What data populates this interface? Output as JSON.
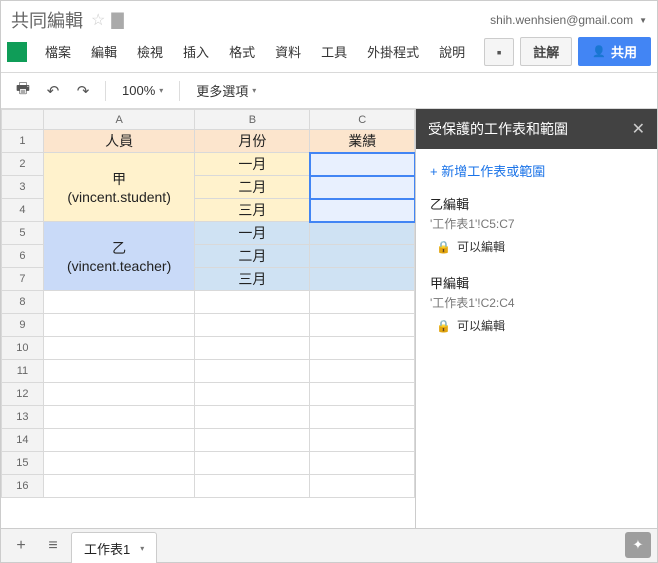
{
  "header": {
    "doc_title": "共同編輯",
    "user_email": "shih.wenhsien@gmail.com"
  },
  "menu": {
    "items": [
      "檔案",
      "編輯",
      "檢視",
      "插入",
      "格式",
      "資料",
      "工具",
      "外掛程式",
      "說明"
    ],
    "comment_label": "註解",
    "share_label": "共用"
  },
  "toolbar": {
    "zoom": "100%",
    "more_options": "更多選項"
  },
  "columns": [
    "A",
    "B",
    "C"
  ],
  "rows": [
    "1",
    "2",
    "3",
    "4",
    "5",
    "6",
    "7",
    "8",
    "9",
    "10",
    "11",
    "12",
    "13",
    "14",
    "15",
    "16"
  ],
  "cells": {
    "header_person": "人員",
    "header_month": "月份",
    "header_perf": "業績",
    "jia_line1": "甲",
    "jia_line2": "(vincent.student)",
    "yi_line1": "乙",
    "yi_line2": "(vincent.teacher)",
    "m1": "一月",
    "m2": "二月",
    "m3": "三月",
    "m4": "一月",
    "m5": "二月",
    "m6": "三月"
  },
  "panel": {
    "title": "受保護的工作表和範圍",
    "add_range": "+ 新增工作表或範圍",
    "ranges": [
      {
        "name": "乙編輯",
        "ref": "'工作表1'!C5:C7",
        "perm": "可以編輯"
      },
      {
        "name": "甲編輯",
        "ref": "'工作表1'!C2:C4",
        "perm": "可以編輯"
      }
    ]
  },
  "footer": {
    "sheet1": "工作表1"
  }
}
